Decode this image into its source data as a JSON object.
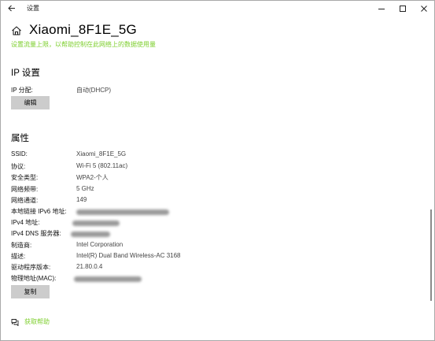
{
  "titlebar": {
    "title": "设置",
    "back_icon": "back-arrow-icon",
    "minimize_icon": "minimize-icon",
    "maximize_icon": "maximize-icon",
    "close_icon": "close-icon"
  },
  "header": {
    "home_icon": "home-icon",
    "title": "Xiaomi_8F1E_5G",
    "metered_link": "设置流量上限，以帮助控制在此网络上的数据使用量"
  },
  "ip_settings": {
    "heading": "IP 设置",
    "assignment_label": "IP 分配:",
    "assignment_value": "自动(DHCP)",
    "edit_button": "编辑"
  },
  "properties": {
    "heading": "属性",
    "rows": [
      {
        "label": "SSID:",
        "value": "Xiaomi_8F1E_5G"
      },
      {
        "label": "协议:",
        "value": "Wi-Fi 5 (802.11ac)"
      },
      {
        "label": "安全类型:",
        "value": "WPA2-个人"
      },
      {
        "label": "网络频带:",
        "value": "5 GHz"
      },
      {
        "label": "网络通道:",
        "value": "149"
      },
      {
        "label": "本地链接 IPv6 地址:",
        "value": ""
      },
      {
        "label": "IPv4 地址:",
        "value": ""
      },
      {
        "label": "IPv4 DNS 服务器:",
        "value": ""
      },
      {
        "label": "制造商:",
        "value": "Intel Corporation"
      },
      {
        "label": "描述:",
        "value": "Intel(R) Dual Band Wireless-AC 3168"
      },
      {
        "label": "驱动程序版本:",
        "value": "21.80.0.4"
      },
      {
        "label": "物理地址(MAC):",
        "value": ""
      }
    ],
    "copy_button": "复制"
  },
  "help": {
    "icon": "chat-help-icon",
    "label": "获取帮助"
  },
  "colors": {
    "accent_green": "#7ecf2e",
    "button_gray": "#cccccc"
  }
}
